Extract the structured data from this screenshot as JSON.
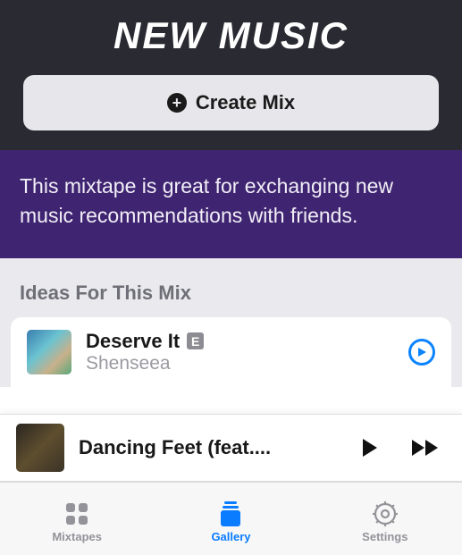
{
  "header": {
    "title": "NEW MUSIC",
    "create_label": "Create Mix"
  },
  "description": "This mixtape is great for exchanging new music recommendations with friends.",
  "ideas": {
    "heading": "Ideas For This Mix",
    "tracks": [
      {
        "title": "Deserve It",
        "artist": "Shenseea",
        "explicit_badge": "E"
      }
    ]
  },
  "now_playing": {
    "title": "Dancing Feet (feat...."
  },
  "tabbar": {
    "items": [
      {
        "label": "Mixtapes"
      },
      {
        "label": "Gallery"
      },
      {
        "label": "Settings"
      }
    ]
  },
  "colors": {
    "accent": "#0a84ff",
    "header_bg": "#2a2a33",
    "description_bg": "#3f2571"
  }
}
